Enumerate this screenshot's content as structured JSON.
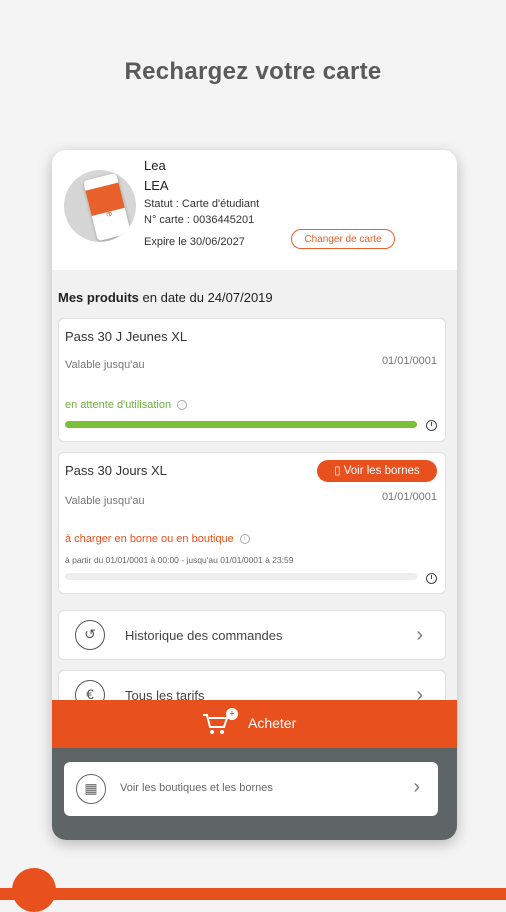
{
  "headline": "Rechargez votre carte",
  "colors": {
    "accent": "#e8501e",
    "green": "#7bbf3a",
    "dark_panel": "#5f6464"
  },
  "profile": {
    "name1": "Lea",
    "name2": "LEA",
    "status": "Statut : Carte d'étudiant",
    "card_number": "N° carte : 0036445201",
    "expires": "Expire le 30/06/2027",
    "change_card_label": "Changer de carte",
    "card_image_text": "carte"
  },
  "products": {
    "title_bold": "Mes produits",
    "title_rest": " en date du 24/07/2019",
    "items": [
      {
        "name": "Pass 30 J Jeunes XL",
        "valid_label": "Valable jusqu'au",
        "valid_date": "01/01/0001",
        "status": "en attente d'utilisation",
        "progress": 1.0
      },
      {
        "name": "Pass 30 Jours XL",
        "button_label": "Voir les bornes",
        "valid_label": "Valable jusqu'au",
        "valid_date": "01/01/0001",
        "status": "à charger en borne ou en boutique",
        "range": "à partir du 01/01/0001 à 00:00  -  jusqu'au 01/01/0001 à 23:59",
        "progress": 0.0
      }
    ]
  },
  "menu": [
    {
      "label": "Historique des commandes",
      "icon": "history-icon"
    },
    {
      "label": "Tous les tarifs",
      "icon": "euro-icon"
    }
  ],
  "buy": {
    "label": "Acheter",
    "badge": "+"
  },
  "shops": {
    "label": "Voir les boutiques et les bornes",
    "icon": "shop-icon"
  }
}
